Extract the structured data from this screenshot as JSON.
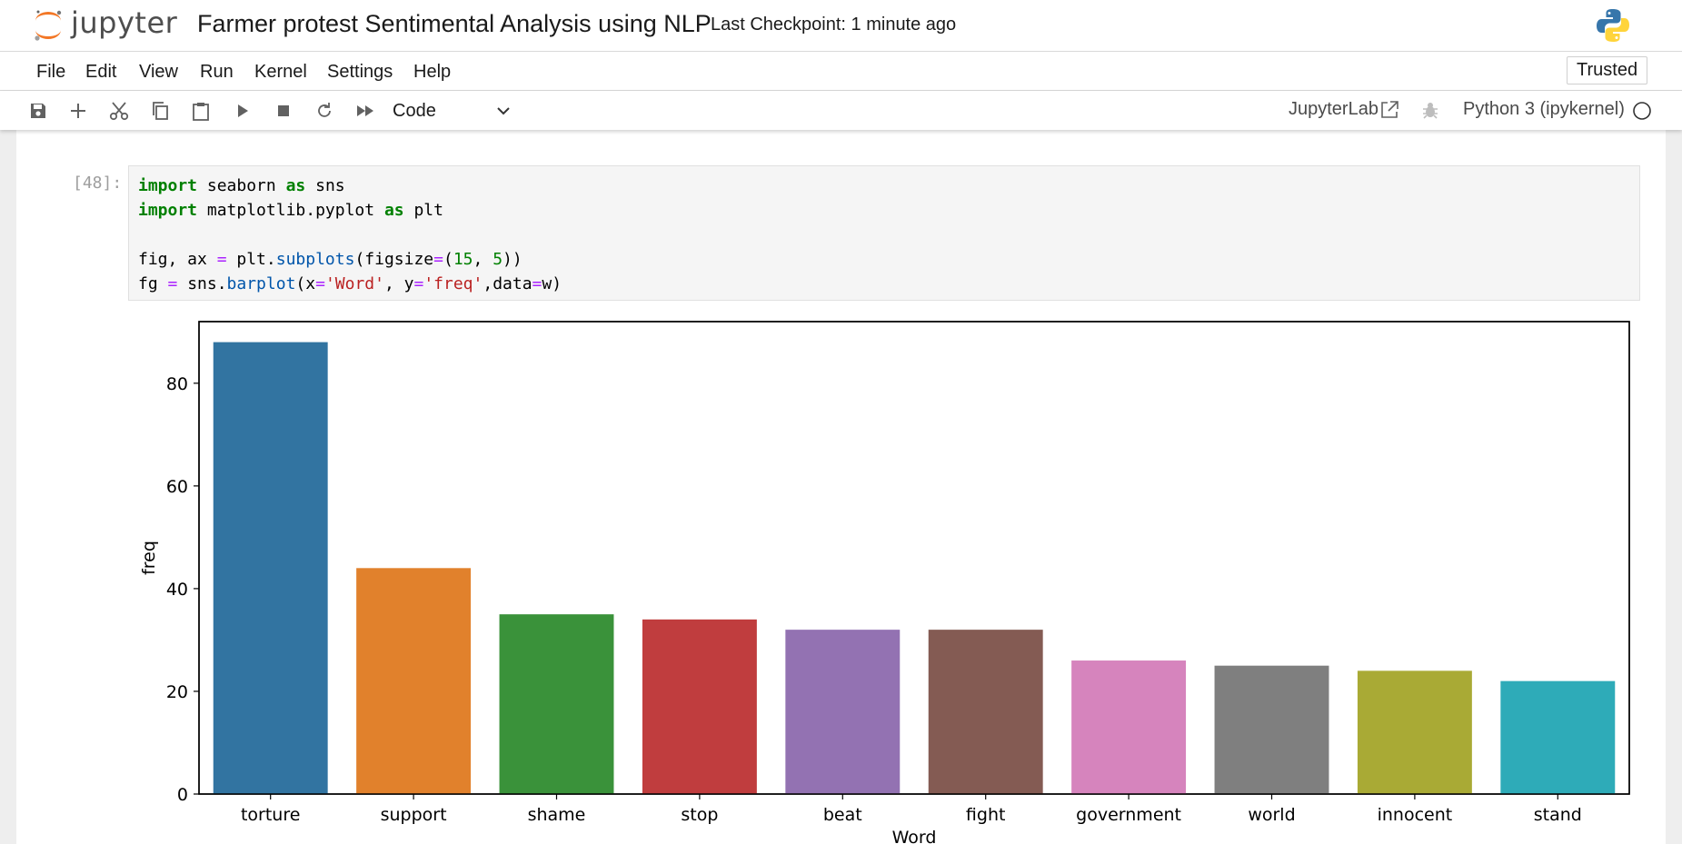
{
  "header": {
    "logo_text": "jupyter",
    "notebook_title": "Farmer protest Sentimental Analysis using NLP",
    "checkpoint": "Last Checkpoint: 1 minute ago"
  },
  "menubar": {
    "items": [
      "File",
      "Edit",
      "View",
      "Run",
      "Kernel",
      "Settings",
      "Help"
    ],
    "trusted": "Trusted"
  },
  "toolbar": {
    "cell_type": "Code",
    "jupyterlab_label": "JupyterLab",
    "kernel_name": "Python 3 (ipykernel)"
  },
  "cell": {
    "prompt": "[48]:",
    "code_lines": [
      "import seaborn as sns",
      "import matplotlib.pyplot as plt",
      "",
      "fig, ax = plt.subplots(figsize=(15, 5))",
      "fg = sns.barplot(x='Word', y='freq',data=w)"
    ]
  },
  "chart_data": {
    "type": "bar",
    "categories": [
      "torture",
      "support",
      "shame",
      "stop",
      "beat",
      "fight",
      "government",
      "world",
      "innocent",
      "stand"
    ],
    "values": [
      88,
      44,
      35,
      34,
      32,
      32,
      26,
      25,
      24,
      22
    ],
    "colors": [
      "#3274a1",
      "#e1812c",
      "#3a923a",
      "#c03d3e",
      "#9372b2",
      "#845b53",
      "#d684bd",
      "#7f7f7f",
      "#a9aa35",
      "#2eabb8"
    ],
    "title": "",
    "xlabel": "Word",
    "ylabel": "freq",
    "ylim": [
      0,
      92
    ],
    "yticks": [
      0,
      20,
      40,
      60,
      80
    ],
    "grid": false
  }
}
